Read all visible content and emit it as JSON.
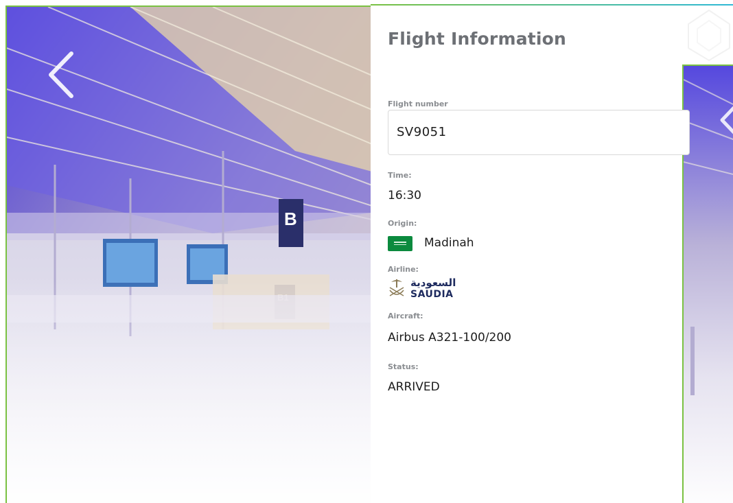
{
  "page": {
    "title": "Flight Information"
  },
  "flight": {
    "number_label": "Flight number",
    "number_value": "SV9051",
    "time_label": "Time:",
    "time_value": "16:30",
    "origin_label": "Origin:",
    "origin_value": "Madinah",
    "origin_flag": "saudi-arabia-flag",
    "airline_label": "Airline:",
    "airline_logo_ar": "السعودية",
    "airline_logo_en": "SAUDIA",
    "aircraft_label": "Aircraft:",
    "aircraft_value": "Airbus A321-100/200",
    "status_label": "Status:",
    "status_value": "ARRIVED"
  },
  "colors": {
    "accent_green": "#7ac142",
    "accent_teal": "#2fb9d6",
    "title_gray": "#6d7075",
    "label_gray": "#8a8d91",
    "saudia_blue": "#1d2a5e"
  },
  "icons": {
    "back": "chevron-left-icon"
  }
}
